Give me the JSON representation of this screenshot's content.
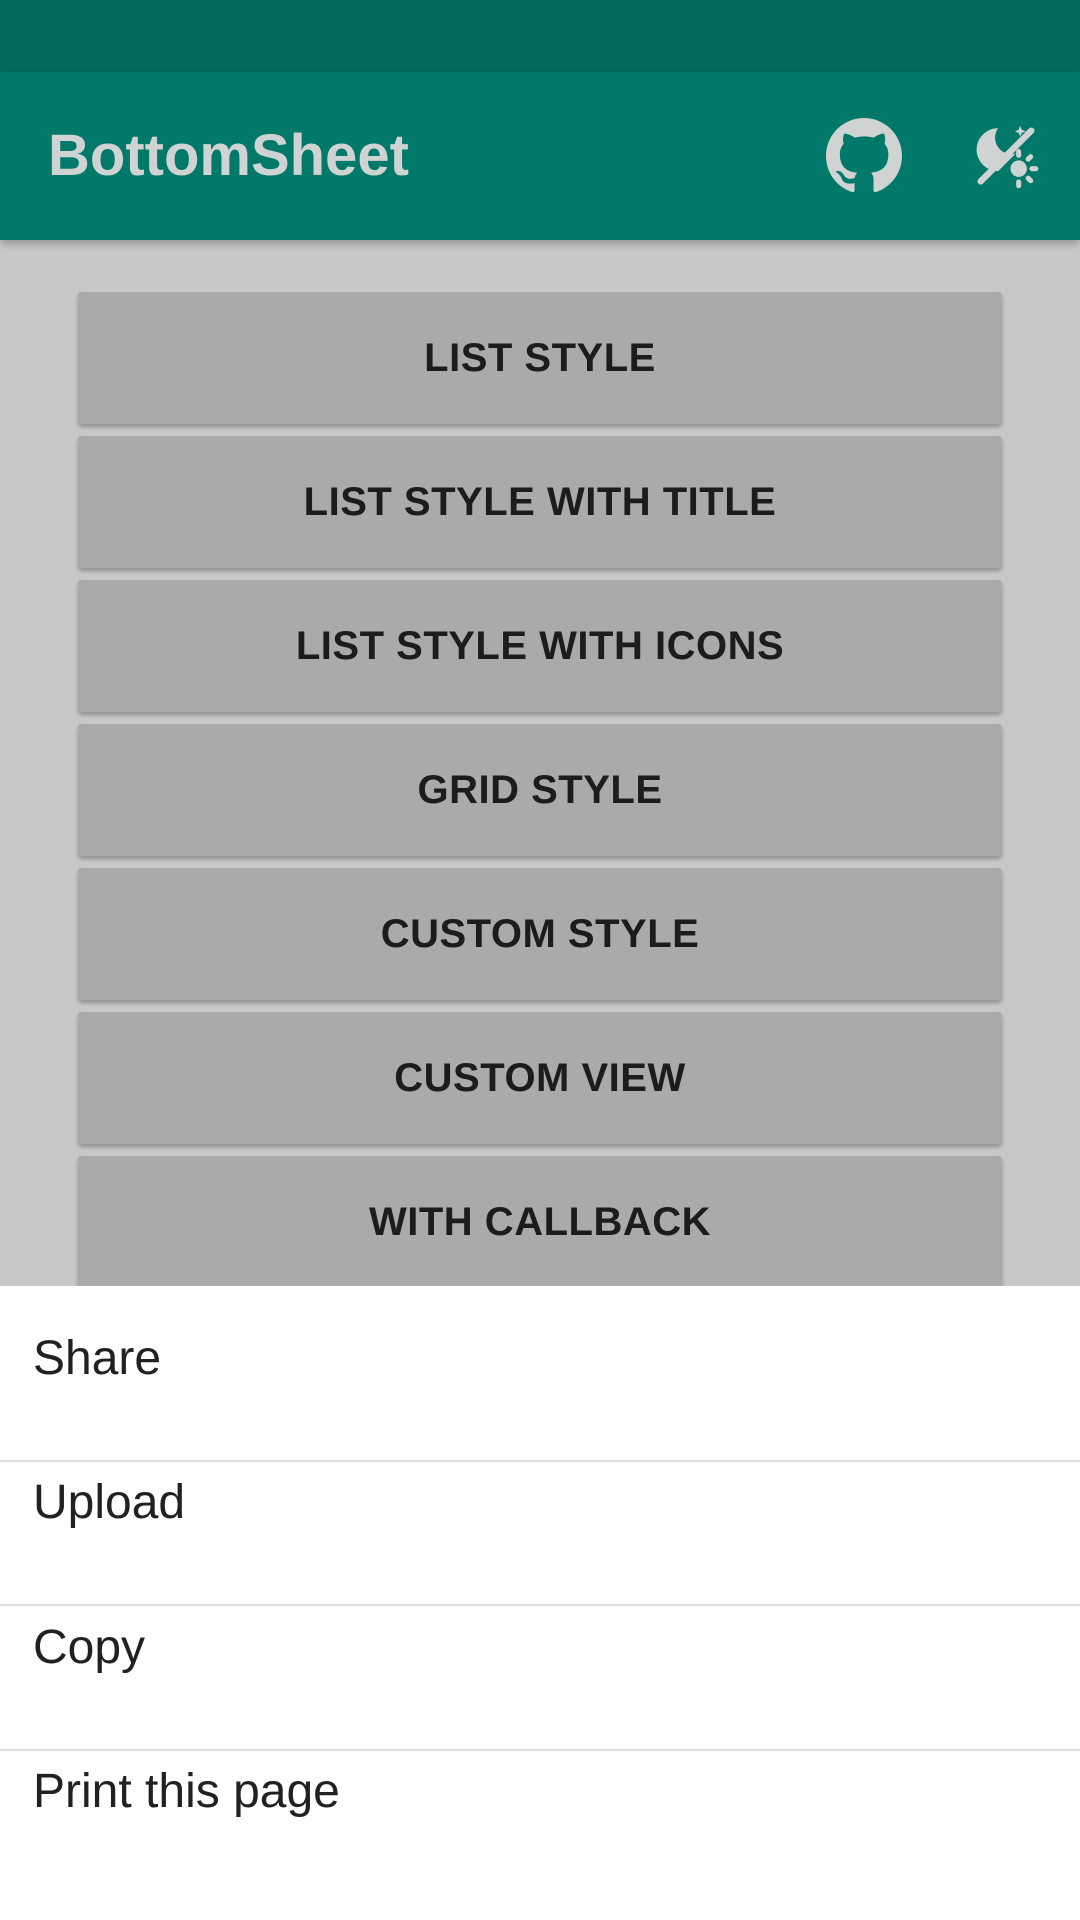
{
  "app": {
    "title": "BottomSheet",
    "colors": {
      "status_bar": "#00695c",
      "app_bar": "#00796b",
      "title_text": "#cfd3d2",
      "content_bg": "#c8c8c8",
      "button_bg": "#a9aaaa",
      "sheet_bg": "#ffffff"
    },
    "actions": [
      {
        "icon": "github-icon"
      },
      {
        "icon": "theme-toggle-icon"
      }
    ]
  },
  "buttons": [
    {
      "label": "LIST STYLE"
    },
    {
      "label": "LIST STYLE WITH TITLE"
    },
    {
      "label": "LIST STYLE WITH ICONS"
    },
    {
      "label": "GRID STYLE"
    },
    {
      "label": "CUSTOM STYLE"
    },
    {
      "label": "CUSTOM VIEW"
    },
    {
      "label": "WITH CALLBACK"
    }
  ],
  "sheet": {
    "items": [
      {
        "label": "Share"
      },
      {
        "label": "Upload"
      },
      {
        "label": "Copy"
      },
      {
        "label": "Print this page"
      }
    ]
  }
}
